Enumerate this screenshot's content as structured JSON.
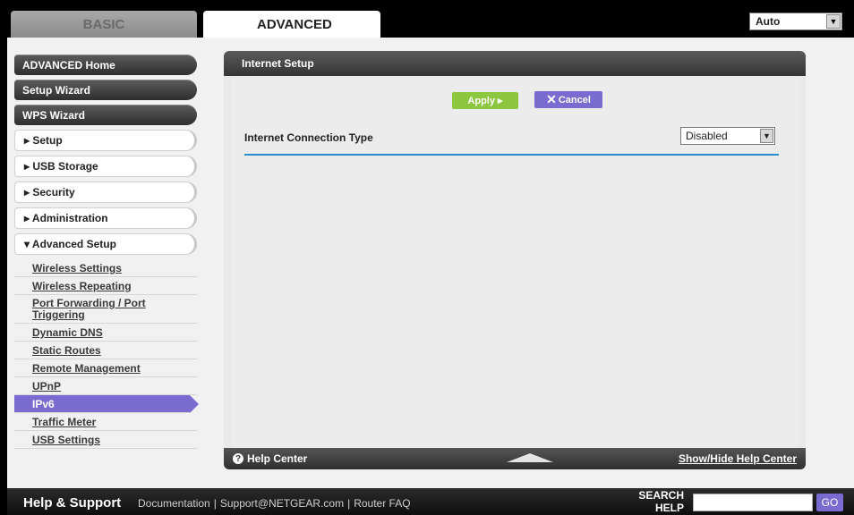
{
  "tabs": {
    "basic": "BASIC",
    "advanced": "ADVANCED"
  },
  "language": {
    "value": "Auto"
  },
  "menu": {
    "main": [
      "ADVANCED Home",
      "Setup Wizard",
      "WPS Wizard"
    ],
    "sections": [
      "▸ Setup",
      "▸ USB Storage",
      "▸ Security",
      "▸ Administration",
      "▾ Advanced Setup"
    ],
    "submenu": [
      "Wireless Settings",
      "Wireless Repeating",
      "Port Forwarding / Port Triggering",
      "Dynamic DNS",
      "Static Routes",
      "Remote Management",
      "UPnP",
      "IPv6",
      "Traffic Meter",
      "USB Settings"
    ]
  },
  "panel": {
    "title": "Internet Setup",
    "apply_label": "Apply ▸",
    "cancel_label": "Cancel",
    "connection_type_label": "Internet Connection Type",
    "connection_type_value": "Disabled",
    "help_center": "Help Center",
    "show_hide": "Show/Hide Help Center"
  },
  "footer": {
    "title": "Help & Support",
    "links": [
      "Documentation",
      "Support@NETGEAR.com",
      "Router FAQ"
    ],
    "search_label_1": "SEARCH",
    "search_label_2": "HELP",
    "go_label": "GO"
  },
  "colors": {
    "accent": "#7a6bd0",
    "apply": "#8dc63f",
    "divider": "#2a8bd0"
  }
}
